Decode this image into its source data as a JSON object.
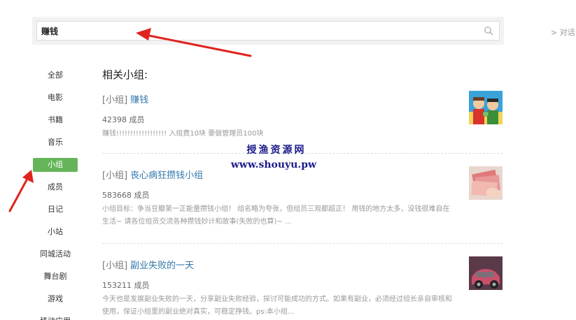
{
  "search": {
    "value": "赚钱"
  },
  "right_link": "> 对话",
  "sidebar": {
    "items": [
      {
        "label": "全部"
      },
      {
        "label": "电影"
      },
      {
        "label": "书籍"
      },
      {
        "label": "音乐"
      },
      {
        "label": "小组"
      },
      {
        "label": "成员"
      },
      {
        "label": "日记"
      },
      {
        "label": "小站"
      },
      {
        "label": "同城活动"
      },
      {
        "label": "舞台剧"
      },
      {
        "label": "游戏"
      },
      {
        "label": "移动应用"
      }
    ],
    "active_index": 4
  },
  "main": {
    "section_title": "相关小组:",
    "results": [
      {
        "tag": "[小组]",
        "name": "赚钱",
        "members": "42398 成员",
        "desc": "赚钱!!!!!!!!!!!!!!!!!! 入组费10块 要做管理员100块"
      },
      {
        "tag": "[小组]",
        "name": "丧心病狂攒钱小组",
        "members": "583668 成员",
        "desc": "小组目标：争当豆瓣第一正能量攒钱小组！ 组名略为夸张，但组员三观都超正！ 用钱的地方太多，没钱很难自在生活~ 请各位组员交流各种攒钱妙计和故事(失败的也算)~ ..."
      },
      {
        "tag": "[小组]",
        "name": "副业失败的一天",
        "members": "153211 成员",
        "desc": "今天也是发展副业失败的一天，分享副业失败经验，探讨可能成功的方式。如果有副业，必须经过组长亲自审核和使用，保证小组里的副业绝对真实，可稳定挣钱。ps:本小组..."
      }
    ]
  },
  "watermark": {
    "title": "授渔资源网",
    "url": "www.shouyu.pw"
  },
  "colors": {
    "active_green": "#66b45a",
    "link_blue": "#3377aa",
    "arrow_red": "#e0231f",
    "watermark_blue": "#1b1b8c"
  }
}
